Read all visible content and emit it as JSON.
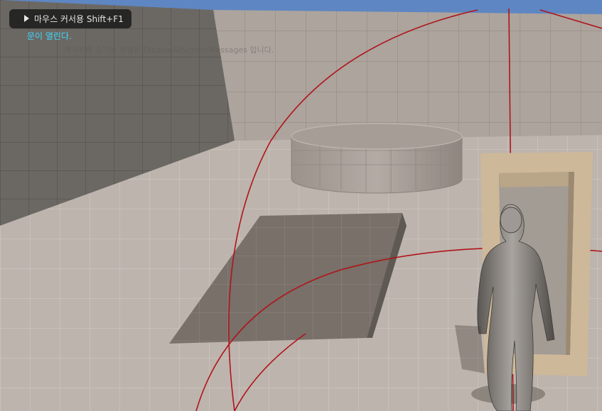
{
  "hud": {
    "mouse_tip": "마우스 커서용 Shift+F1",
    "screen_message": "문이 열린다.",
    "faded_hint": "메시지를 숨기는 명령은 DisableAllScreenMessages 입니다."
  },
  "colors": {
    "sky": "#5e86c2",
    "wall_light": "#aba39c",
    "wall_dark": "#6c6965",
    "floor": "#bcb3ac",
    "ramp": "#7a736c",
    "door_frame": "#d2bd9c",
    "debug_line": "#b0141a",
    "message_text": "#3fd9ff"
  },
  "icons": {
    "mouse_tip_icon": "cursor-arrow-icon"
  }
}
